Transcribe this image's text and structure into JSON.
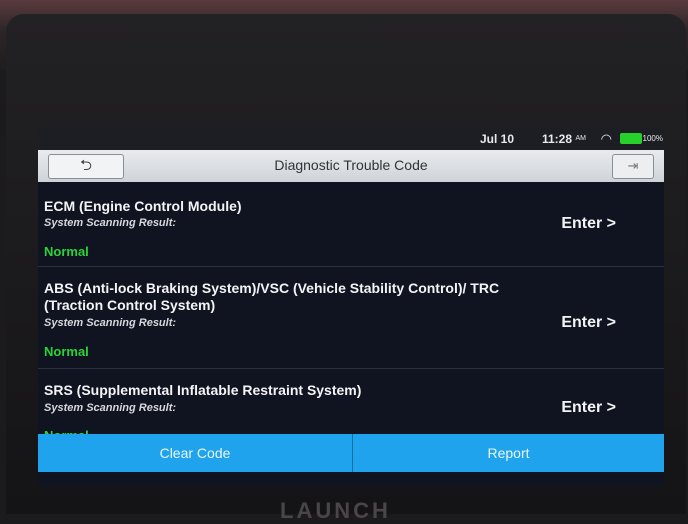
{
  "status_bar": {
    "date": "Jul 10",
    "time": "11:28",
    "ampm": "AM",
    "battery": "100%"
  },
  "header": {
    "title": "Diagnostic Trouble Code",
    "back_icon": "back-arrow-icon",
    "exit_icon": "exit-icon"
  },
  "systems": [
    {
      "name": "ECM (Engine Control Module)",
      "result_label": "System Scanning Result:",
      "status": "Normal",
      "action": "Enter >"
    },
    {
      "name": "ABS (Anti-lock Braking System)/VSC (Vehicle Stability Control)/ TRC (Traction Control System)",
      "result_label": "System Scanning Result:",
      "status": "Normal",
      "action": "Enter >"
    },
    {
      "name": "SRS (Supplemental Inflatable Restraint System)",
      "result_label": "System Scanning Result:",
      "status": "Normal",
      "action": "Enter >"
    }
  ],
  "footer": {
    "clear_label": "Clear Code",
    "report_label": "Report"
  },
  "brand": "LAUNCH",
  "colors": {
    "accent": "#1ea3ec",
    "normal_status": "#2bd33a",
    "battery": "#27d02a"
  }
}
